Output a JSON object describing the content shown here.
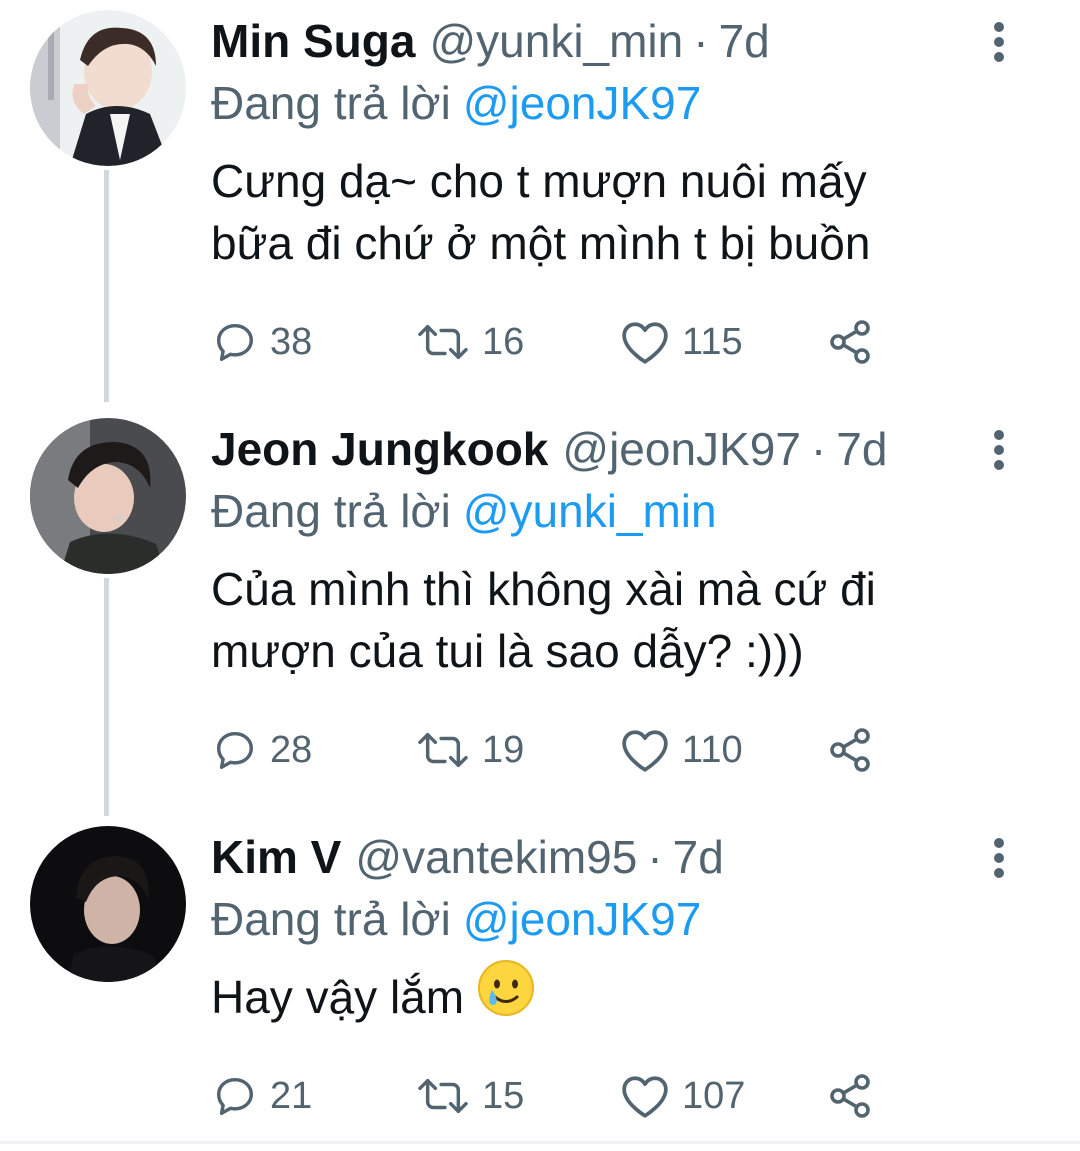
{
  "colors": {
    "text_primary": "#0f1419",
    "text_secondary": "#536471",
    "link": "#1d9bf0",
    "thread_line": "#cfd9de"
  },
  "tweets": [
    {
      "name": "Min Suga",
      "handle": "@yunki_min",
      "time": "7d",
      "reply_prefix": "Đang trả lời",
      "reply_to": "@jeonJK97",
      "text_lines": [
        "Cưng dạ~ cho t mượn nuôi mấy",
        "bữa đi chứ ở một mình t bị buồn"
      ],
      "replies": "38",
      "retweets": "16",
      "likes": "115"
    },
    {
      "name": "Jeon Jungkook",
      "handle": "@jeonJK97",
      "time": "7d",
      "reply_prefix": "Đang trả lời",
      "reply_to": "@yunki_min",
      "text_lines": [
        "Của mình thì không xài mà cứ đi",
        "mượn của tui là sao dẫy? :)))"
      ],
      "replies": "28",
      "retweets": "19",
      "likes": "110"
    },
    {
      "name": "Kim V",
      "handle": "@vantekim95",
      "time": "7d",
      "reply_prefix": "Đang trả lời",
      "reply_to": "@jeonJK97",
      "text_lines": [
        "Hay vậy lắm"
      ],
      "emoji": "smiling-face-with-tear",
      "replies": "21",
      "retweets": "15",
      "likes": "107"
    }
  ],
  "icons": {
    "reply": "reply-icon",
    "retweet": "retweet-icon",
    "like": "heart-icon",
    "share": "share-icon",
    "more": "more-vertical-icon"
  }
}
